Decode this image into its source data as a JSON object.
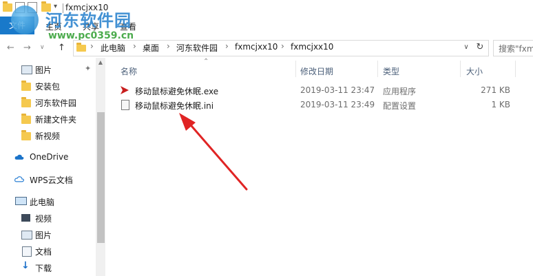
{
  "window": {
    "title": "fxmcjxx10"
  },
  "watermark": {
    "logo_text": "文件",
    "title": "河东软件园",
    "url": "www.pc0359.cn"
  },
  "ribbon": {
    "file_tab": "文件",
    "tabs": [
      "主页",
      "共享",
      "查看"
    ]
  },
  "nav": {
    "back": "←",
    "forward": "→",
    "up": "↑",
    "breadcrumbs": [
      "此电脑",
      "桌面",
      "河东软件园",
      "fxmcjxx10",
      "fxmcjxx10"
    ],
    "crumb_sep": "›",
    "dropdown": "∨",
    "refresh": "↻",
    "search_placeholder": "搜索\"fxm"
  },
  "sidebar": {
    "items": [
      {
        "label": "图片",
        "icon": "picture-icon",
        "pinned": true
      },
      {
        "label": "安装包",
        "icon": "folder-icon"
      },
      {
        "label": "河东软件园",
        "icon": "folder-icon"
      },
      {
        "label": "新建文件夹",
        "icon": "folder-icon"
      },
      {
        "label": "新视频",
        "icon": "folder-icon"
      },
      {
        "label": "OneDrive",
        "icon": "cloud-icon"
      },
      {
        "label": "WPS云文档",
        "icon": "wps-cloud-icon"
      },
      {
        "label": "此电脑",
        "icon": "computer-icon"
      },
      {
        "label": "视频",
        "icon": "video-icon"
      },
      {
        "label": "图片",
        "icon": "picture-icon"
      },
      {
        "label": "文档",
        "icon": "document-icon"
      },
      {
        "label": "下载",
        "icon": "download-icon"
      }
    ]
  },
  "filelist": {
    "columns": [
      "名称",
      "修改日期",
      "类型",
      "大小"
    ],
    "rows": [
      {
        "name": "移动鼠标避免休眠.exe",
        "date": "2019-03-11 23:47",
        "type": "应用程序",
        "size": "271 KB",
        "icon": "exe-icon"
      },
      {
        "name": "移动鼠标避免休眠.ini",
        "date": "2019-03-11 23:49",
        "type": "配置设置",
        "size": "1 KB",
        "icon": "ini-file-icon"
      }
    ]
  },
  "colors": {
    "accent": "#1979ca",
    "folder": "#f5c94e",
    "arrow": "#e02424"
  }
}
